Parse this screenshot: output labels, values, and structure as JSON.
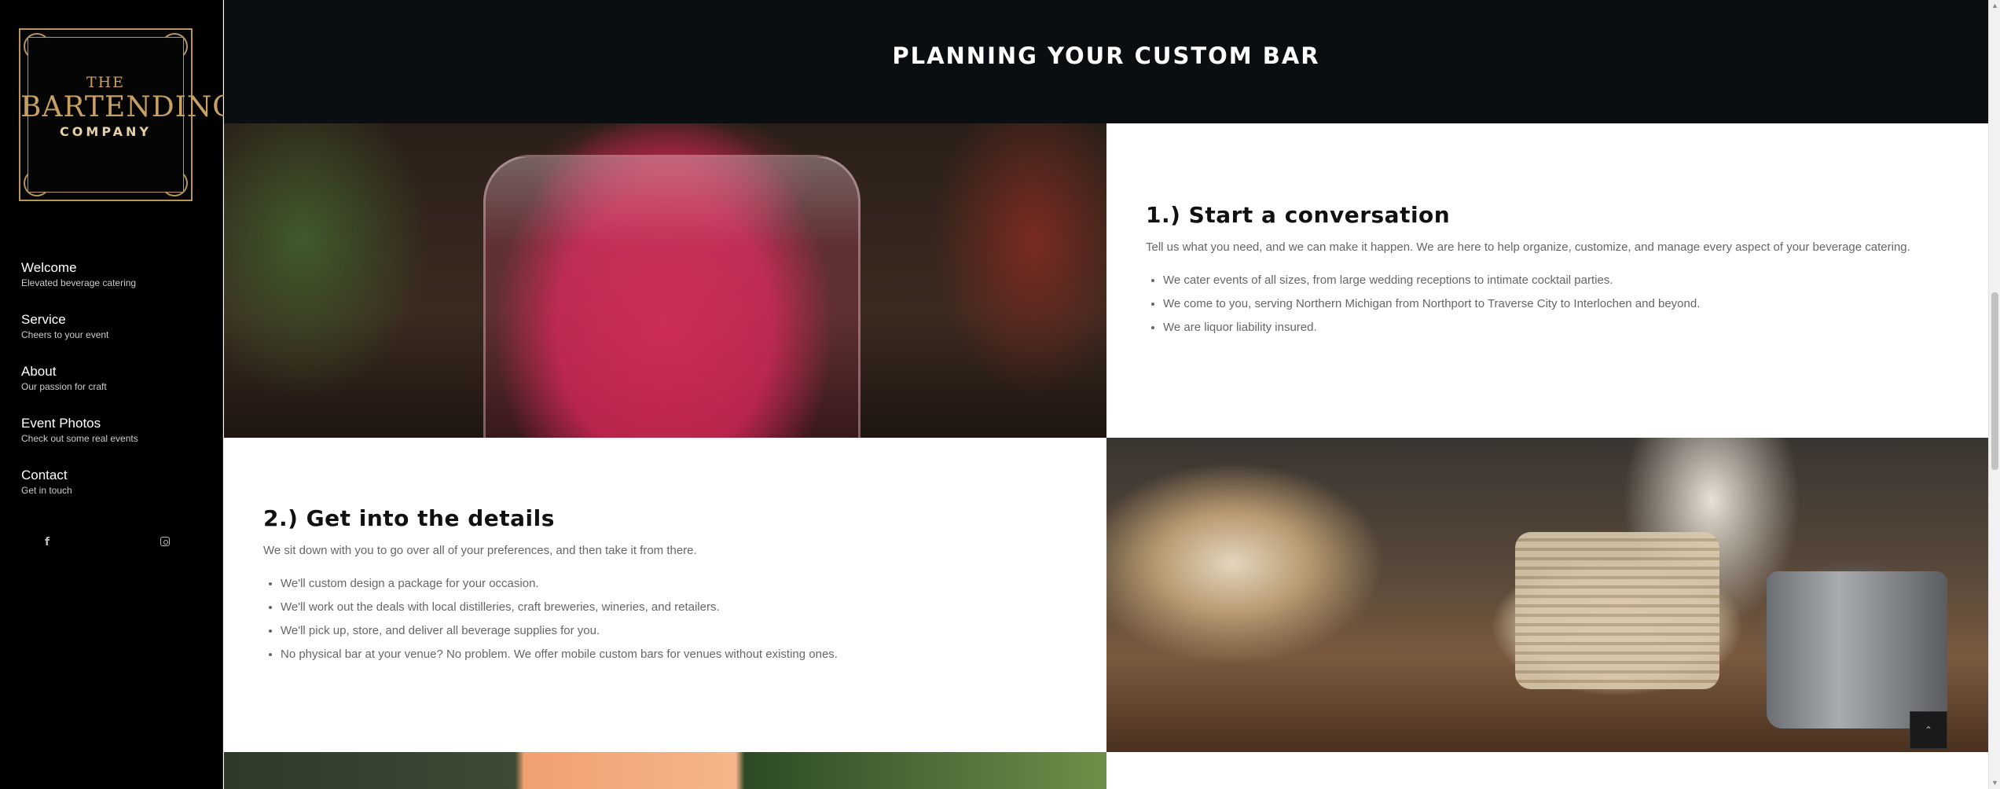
{
  "sidebar": {
    "logo": {
      "line1": "THE",
      "line2": "BARTENDING",
      "line3": "COMPANY",
      "accent": "#c9a063"
    },
    "nav": [
      {
        "label": "Welcome",
        "sublabel": "Elevated beverage catering"
      },
      {
        "label": "Service",
        "sublabel": "Cheers to your event"
      },
      {
        "label": "About",
        "sublabel": "Our passion for craft"
      },
      {
        "label": "Event Photos",
        "sublabel": "Check out some real events"
      },
      {
        "label": "Contact",
        "sublabel": "Get in touch"
      }
    ],
    "social": {
      "facebook_glyph": "f",
      "instagram_icon": "instagram-icon"
    }
  },
  "header": {
    "title": "PLANNING YOUR CUSTOM BAR"
  },
  "step1": {
    "heading": "1.) Start a conversation",
    "intro": "Tell us what you need, and we can make it happen. We are here to help organize, customize, and manage every aspect of your beverage catering.",
    "bullets": [
      "We cater events of all sizes, from large wedding receptions to intimate cocktail parties.",
      "We come to you, serving Northern Michigan from Northport to Traverse City to Interlochen and beyond.",
      "We are liquor liability insured."
    ]
  },
  "step2": {
    "heading": "2.) Get into the details",
    "intro": "We sit down with you to go over all of your preferences, and then take it from there.",
    "bullets": [
      "We'll custom design a package for your occasion.",
      "We'll work out the deals with local distilleries, craft breweries, wineries, and retailers.",
      "We'll pick up, store, and deliver all beverage supplies for you.",
      "No physical bar at your venue? No problem. We offer mobile custom bars for venues without existing ones."
    ]
  },
  "controls": {
    "back_to_top_glyph": "⌃",
    "scroll_up_glyph": "▲",
    "scroll_down_glyph": "▼"
  }
}
